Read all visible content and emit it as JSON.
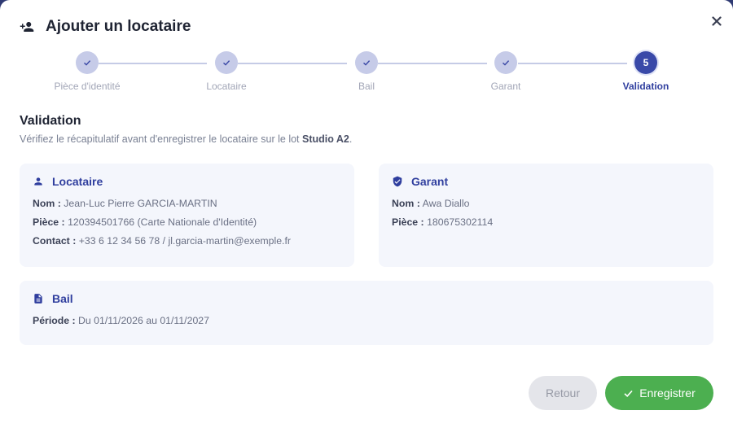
{
  "dialog": {
    "title": "Ajouter un locataire",
    "title_icon": "person-add-icon",
    "close_icon": "close-icon"
  },
  "stepper": {
    "steps": [
      {
        "label": "Pièce d'identité",
        "state": "done",
        "icon": "check-icon"
      },
      {
        "label": "Locataire",
        "state": "done",
        "icon": "check-icon"
      },
      {
        "label": "Bail",
        "state": "done",
        "icon": "check-icon"
      },
      {
        "label": "Garant",
        "state": "done",
        "icon": "check-icon"
      },
      {
        "label": "Validation",
        "state": "active",
        "number": "5"
      }
    ]
  },
  "section": {
    "title": "Validation",
    "subtitle_before": "Vérifiez le récapitulatif avant d'enregistrer le locataire sur le lot ",
    "lot": "Studio A2",
    "subtitle_after": "."
  },
  "locataire": {
    "title": "Locataire",
    "icon": "person-icon",
    "nom_label": "Nom :",
    "nom": "Jean-Luc Pierre GARCIA-MARTIN",
    "piece_label": "Pièce :",
    "piece": "120394501766 (Carte Nationale d'Identité)",
    "contact_label": "Contact :",
    "contact": "+33 6 12 34 56 78 / jl.garcia-martin@exemple.fr"
  },
  "garant": {
    "title": "Garant",
    "icon": "verified-shield-icon",
    "nom_label": "Nom :",
    "nom": "Awa Diallo",
    "piece_label": "Pièce :",
    "piece": "180675302114"
  },
  "bail": {
    "title": "Bail",
    "icon": "document-icon",
    "periode_label": "Période :",
    "periode": "Du 01/11/2026 au 01/11/2027"
  },
  "actions": {
    "back_label": "Retour",
    "save_label": "Enregistrer",
    "save_icon": "check-icon"
  },
  "colors": {
    "primary": "#3949a8",
    "success": "#4caf50",
    "card_bg": "#f4f6fc"
  }
}
